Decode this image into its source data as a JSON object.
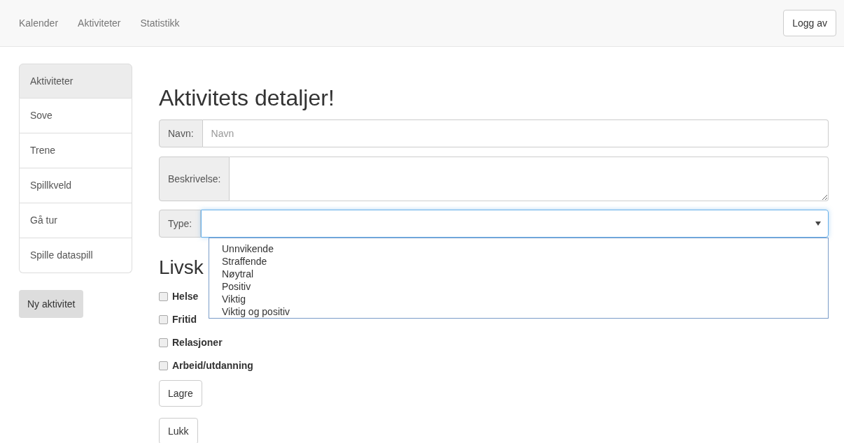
{
  "navbar": {
    "links": [
      {
        "label": "Kalender"
      },
      {
        "label": "Aktiviteter"
      },
      {
        "label": "Statistikk"
      }
    ],
    "logout": "Logg av"
  },
  "sidebar": {
    "items": [
      {
        "label": "Aktiviteter",
        "selected": true
      },
      {
        "label": "Sove",
        "selected": false
      },
      {
        "label": "Trene",
        "selected": false
      },
      {
        "label": "Spillkveld",
        "selected": false
      },
      {
        "label": "Gå tur",
        "selected": false
      },
      {
        "label": "Spille dataspill",
        "selected": false
      }
    ],
    "new_button": "Ny aktivitet"
  },
  "form": {
    "title": "Aktivitets detaljer!",
    "name": {
      "label": "Navn:",
      "placeholder": "Navn"
    },
    "description": {
      "label": "Beskrivelse:"
    },
    "type": {
      "label": "Type:",
      "open": true,
      "options": [
        {
          "label": "Unnvikende"
        },
        {
          "label": "Straffende"
        },
        {
          "label": "Nøytral"
        },
        {
          "label": "Positiv"
        },
        {
          "label": "Viktig"
        },
        {
          "label": "Viktig og positiv"
        }
      ]
    },
    "section_title": "Livsk",
    "checkboxes": [
      {
        "label": "Helse",
        "checked": false
      },
      {
        "label": "Fritid",
        "checked": false
      },
      {
        "label": "Relasjoner",
        "checked": false
      },
      {
        "label": "Arbeid/utdanning",
        "checked": false
      }
    ],
    "buttons": [
      "Lagre",
      "Lukk"
    ]
  }
}
